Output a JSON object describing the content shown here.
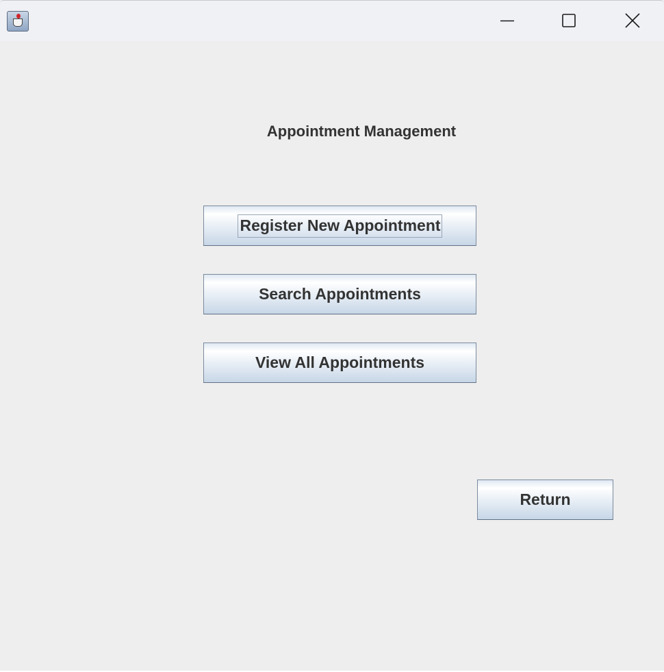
{
  "window": {
    "close_icon": "close-icon",
    "maximize_icon": "maximize-icon",
    "minimize_icon": "minimize-icon",
    "app_icon": "java-cup-icon"
  },
  "main": {
    "title": "Appointment Management",
    "buttons": {
      "register": "Register New Appointment",
      "search": "Search Appointments",
      "view_all": "View All Appointments",
      "return": "Return"
    },
    "focused_button": "register"
  }
}
